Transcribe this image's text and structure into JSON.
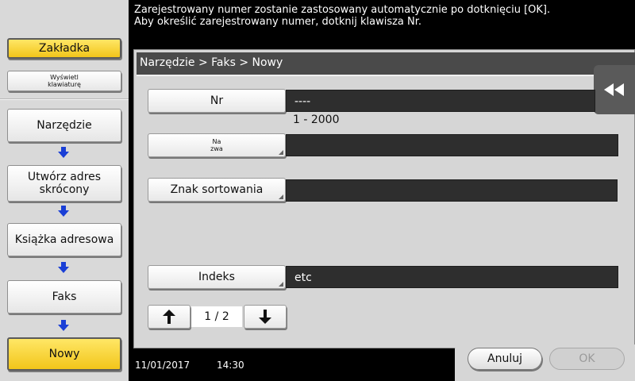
{
  "message": {
    "line1": "Zarejestrowany numer zostanie zastosowany automatycznie po dotknięciu [OK].",
    "line2": "Aby określić zarejestrowany numer, dotknij klawisza Nr."
  },
  "sidebar": {
    "bookmark_label": "Zakładka",
    "show_keyboard_line1": "Wyświetl",
    "show_keyboard_line2": "klawiaturę",
    "steps": [
      {
        "label": "Narzędzie"
      },
      {
        "label_line1": "Utwórz adres",
        "label_line2": "skrócony"
      },
      {
        "label": "Książka adresowa"
      },
      {
        "label": "Faks"
      },
      {
        "label": "Nowy"
      }
    ]
  },
  "breadcrumb": "Narzędzie > Faks > Nowy",
  "form": {
    "nr_label": "Nr",
    "nr_value": "----",
    "nr_range": "1 - 2000",
    "name_label_line1": "Na",
    "name_label_line2": "zwa",
    "name_value": "",
    "sort_label": "Znak sortowania",
    "sort_value": "",
    "index_label": "Indeks",
    "index_value": "etc"
  },
  "pager": {
    "current": "1",
    "separator": "/",
    "total": "2"
  },
  "status": {
    "date": "11/01/2017",
    "time": "14:30"
  },
  "actions": {
    "cancel": "Anuluj",
    "ok": "OK"
  },
  "colors": {
    "selected_yellow": "#f2c51a",
    "arrow_blue": "#1a3fd6",
    "panel_gray": "#d6d6d6"
  }
}
